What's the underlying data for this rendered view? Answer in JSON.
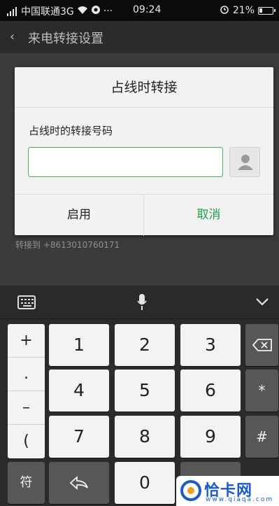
{
  "status_bar": {
    "carrier": "中国联通3G",
    "more": "···",
    "time": "09:24",
    "battery": "21%",
    "battery_level": 0.21
  },
  "page": {
    "title": "来电转接设置",
    "forward_to": "转接到 +8613010760171"
  },
  "dialog": {
    "title": "占线时转接",
    "label": "占线时的转接号码",
    "input_value": "",
    "enable_label": "启用",
    "cancel_label": "取消"
  },
  "keyboard": {
    "symbols": [
      "+",
      ".",
      "–",
      "("
    ],
    "digits": [
      "1",
      "2",
      "3",
      "4",
      "5",
      "6",
      "7",
      "8",
      "9"
    ],
    "zero": "0",
    "right_keys": [
      "*",
      "#"
    ],
    "bottom_left": "符"
  },
  "colors": {
    "accent_green": "#229a4b",
    "input_border": "#4cad62"
  },
  "watermark": {
    "brand": "恰卡网",
    "domain": "www.qiaqa.com"
  }
}
